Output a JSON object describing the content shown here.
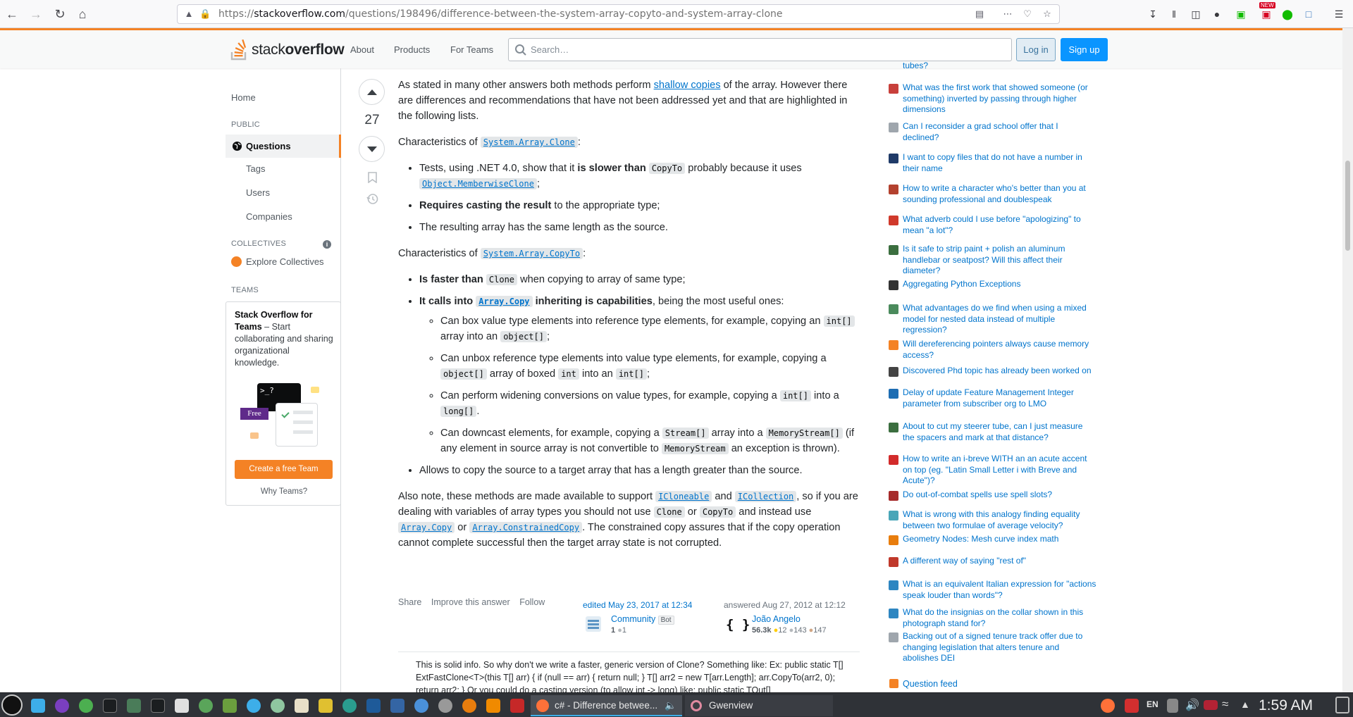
{
  "browser": {
    "url_prefix": "https://",
    "url_host": "stackoverflow.com",
    "url_path": "/questions/198496/difference-between-the-system-array-copyto-and-system-array-clone",
    "new_badge": "NEW"
  },
  "topbar": {
    "logo_light": "stack",
    "logo_bold": "overflow",
    "nav": [
      "About",
      "Products",
      "For Teams"
    ],
    "search_placeholder": "Search…",
    "login": "Log in",
    "signup": "Sign up"
  },
  "left_sidebar": {
    "home": "Home",
    "public_label": "PUBLIC",
    "questions": "Questions",
    "tags": "Tags",
    "users": "Users",
    "companies": "Companies",
    "collectives_label": "COLLECTIVES",
    "explore_collectives": "Explore Collectives",
    "teams_label": "TEAMS",
    "teams_title": "Stack Overflow for Teams",
    "teams_desc": " – Start collaborating and sharing organizational knowledge.",
    "teams_free": "Free",
    "teams_prompt": ">_?",
    "create_team": "Create a free Team",
    "why_teams": "Why Teams?"
  },
  "answer": {
    "votes": "27",
    "p1_pre": "As stated in many other answers both methods perform ",
    "p1_link": "shallow copies",
    "p1_post": " of the array. However there are differences and recommendations that have not been addressed yet and that are highlighted in the following lists.",
    "clone_heading_pre": "Characteristics of ",
    "clone_heading_code": "System.Array.Clone",
    "clone_heading_post": ":",
    "clone_items": {
      "i1_pre": "Tests, using .NET 4.0, show that it ",
      "i1_bold": "is slower than ",
      "i1_code": "CopyTo",
      "i1_mid": " probably because it uses ",
      "i1_code2": "Object.MemberwiseClone",
      "i1_post": ";",
      "i2_bold": "Requires casting the result",
      "i2_post": " to the appropriate type;",
      "i3": "The resulting array has the same length as the source."
    },
    "copyto_heading_pre": "Characteristics of ",
    "copyto_heading_code": "System.Array.CopyTo",
    "copyto_heading_post": ":",
    "copyto_items": {
      "i1_bold": "Is faster than ",
      "i1_code": "Clone",
      "i1_post": " when copying to array of same type;",
      "i2_bold": "It calls into ",
      "i2_code": "Array.Copy",
      "i2_bold2": " inheriting is capabilities",
      "i2_post": ", being the most useful ones:",
      "s1_pre": "Can box value type elements into reference type elements, for example, copying an ",
      "s1_c1": "int[]",
      "s1_mid": " array into an ",
      "s1_c2": "object[]",
      "s1_post": ";",
      "s2_pre": "Can unbox reference type elements into value type elements, for example, copying a ",
      "s2_c1": "object[]",
      "s2_mid": " array of boxed ",
      "s2_c2": "int",
      "s2_mid2": " into an ",
      "s2_c3": "int[]",
      "s2_post": ";",
      "s3_pre": "Can perform widening conversions on value types, for example, copying a ",
      "s3_c1": "int[]",
      "s3_mid": " into a ",
      "s3_c2": "long[]",
      "s3_post": ".",
      "s4_pre": "Can downcast elements, for example, copying a ",
      "s4_c1": "Stream[]",
      "s4_mid": " array into a ",
      "s4_c2": "MemoryStream[]",
      "s4_mid2": " (if any element in source array is not convertible to ",
      "s4_c3": "MemoryStream",
      "s4_post": " an exception is thrown).",
      "i3": "Allows to copy the source to a target array that has a length greater than the source."
    },
    "note_pre": "Also note, these methods are made available to support ",
    "note_c1": "ICloneable",
    "note_and": " and ",
    "note_c2": "ICollection",
    "note_mid": ", so if you are dealing with variables of array types you should not use ",
    "note_c3": "Clone",
    "note_or": " or ",
    "note_c4": "CopyTo",
    "note_mid2": " and instead use ",
    "note_c5": "Array.Copy",
    "note_or2": " or ",
    "note_c6": "Array.ConstrainedCopy",
    "note_post": ". The constrained copy assures that if the copy operation cannot complete successful then the target array state is not corrupted.",
    "menu": [
      "Share",
      "Improve this answer",
      "Follow"
    ],
    "edited": "edited May 23, 2017 at 12:34",
    "editor_name": "Community",
    "editor_badge": "Bot",
    "editor_rep": "1",
    "editor_silver": "1",
    "answered": "answered Aug 27, 2012 at 12:12",
    "owner_name": "João Angelo",
    "owner_rep": "56.3k",
    "owner_gold": "12",
    "owner_silver": "143",
    "owner_bronze": "147",
    "comment": "This is solid info. So why don't we write a faster, generic version of Clone? Something like: Ex: public static T[] ExtFastClone<T>(this T[] arr) { if (null == arr) { return null; } T[] arr2 = new T[arr.Length]; arr.CopyTo(arr2, 0); return arr2; } Or you could do a casting version (to allow int -> long) like: public static TOut[]"
  },
  "hnq": [
    {
      "title": "tubes?",
      "icon": "physics-site-icon",
      "color": "#9fa6ad"
    },
    {
      "title": "What was the first work that showed someone (or something) inverted by passing through higher dimensions",
      "icon": "scifi-site-icon",
      "color": "#c8403b"
    },
    {
      "title": "Can I reconsider a grad school offer that I declined?",
      "icon": "academia-site-icon",
      "color": "#9fa6ad"
    },
    {
      "title": "I want to copy files that do not have a number in their name",
      "icon": "unix-site-icon",
      "color": "#1f3a68"
    },
    {
      "title": "How to write a character who's better than you at sounding professional and doublespeak",
      "icon": "writing-site-icon",
      "color": "#b3412e"
    },
    {
      "title": "What adverb could I use before \"apologizing\" to mean \"a lot\"?",
      "icon": "english-site-icon",
      "color": "#d0392b"
    },
    {
      "title": "Is it safe to strip paint + polish an aluminum handlebar or seatpost? Will this affect their diameter?",
      "icon": "bicycles-site-icon",
      "color": "#3b6e3f"
    },
    {
      "title": "Aggregating Python Exceptions",
      "icon": "codereview-site-icon",
      "color": "#333333"
    },
    {
      "title": "What advantages do we find when using a mixed model for nested data instead of multiple regression?",
      "icon": "stats-site-icon",
      "color": "#4a8a5c"
    },
    {
      "title": "Will dereferencing pointers always cause memory access?",
      "icon": "stackoverflow-site-icon",
      "color": "#f48225"
    },
    {
      "title": "Discovered Phd topic has already been worked on",
      "icon": "mathoverflow-site-icon",
      "color": "#444444"
    },
    {
      "title": "Delay of update Feature Management Integer parameter from subscriber org to LMO",
      "icon": "salesforce-site-icon",
      "color": "#1d6db3"
    },
    {
      "title": "About to cut my steerer tube, can I just measure the spacers and mark at that distance?",
      "icon": "bicycles-site-icon",
      "color": "#3b6e3f"
    },
    {
      "title": "How to write an i-breve WITH an an acute accent on top (eg. \"Latin Small Letter i with Breve and Acute\")?",
      "icon": "tex-site-icon",
      "color": "#d22b2b"
    },
    {
      "title": "Do out-of-combat spells use spell slots?",
      "icon": "rpg-site-icon",
      "color": "#a62b2b"
    },
    {
      "title": "What is wrong with this analogy finding equality between two formulae of average velocity?",
      "icon": "physics-site-icon",
      "color": "#49a6b8"
    },
    {
      "title": "Geometry Nodes: Mesh curve index math",
      "icon": "blender-site-icon",
      "color": "#e87d0d"
    },
    {
      "title": "A different way of saying \"rest of\"",
      "icon": "ell-site-icon",
      "color": "#c0392b"
    },
    {
      "title": "What is an equivalent Italian expression for \"actions speak louder than words\"?",
      "icon": "italian-site-icon",
      "color": "#2e86c1"
    },
    {
      "title": "What do the insignias on the collar shown in this photograph stand for?",
      "icon": "history-site-icon",
      "color": "#2e86c1"
    },
    {
      "title": "Backing out of a signed tenure track offer due to changing legislation that alters tenure and abolishes DEI",
      "icon": "academia-site-icon",
      "color": "#9fa6ad"
    }
  ],
  "question_feed": "Question feed",
  "taskbar": {
    "active_window": "c# - Difference betwee...",
    "gwenview": "Gwenview",
    "lang": "EN",
    "clock": "1:59 AM"
  }
}
